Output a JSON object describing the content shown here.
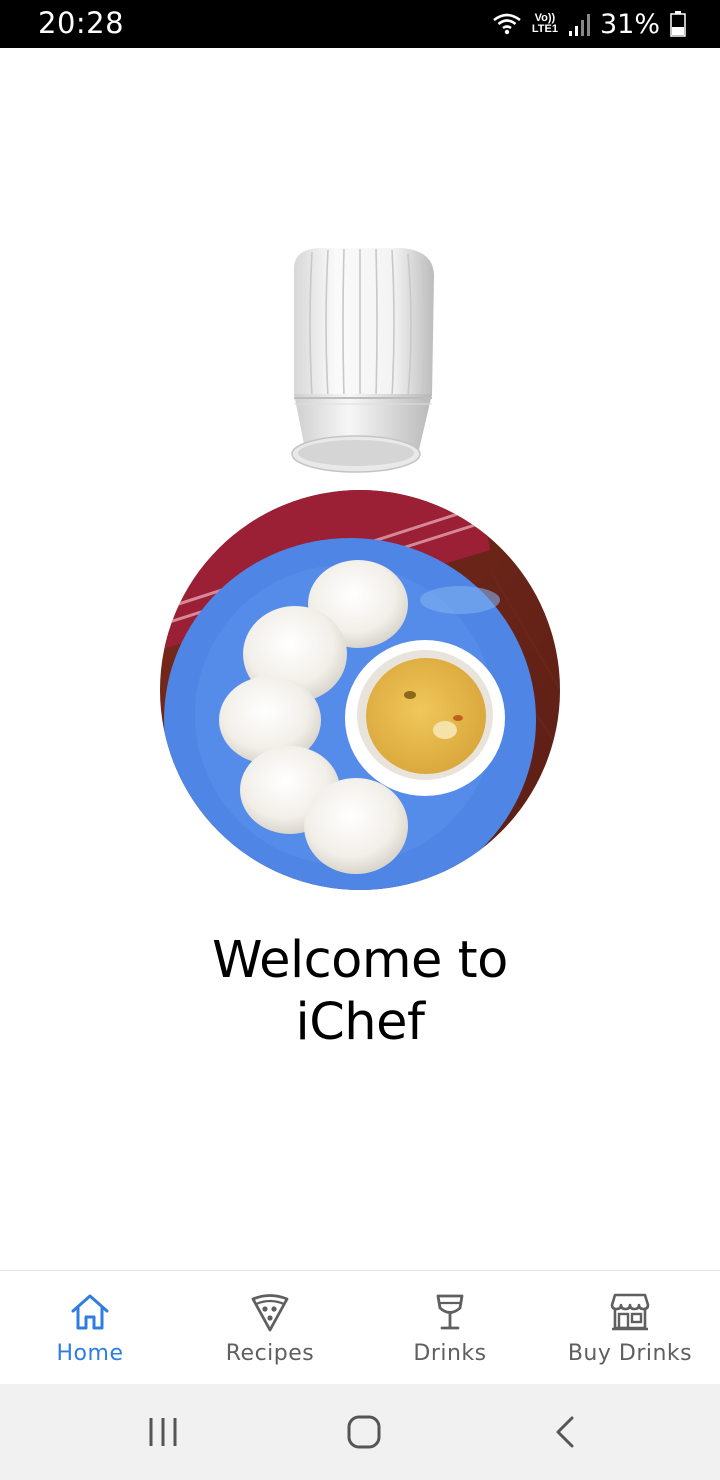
{
  "status_bar": {
    "time": "20:28",
    "volte_label": "Vo))",
    "lte_label": "LTE1",
    "battery_percent": "31%",
    "icons": [
      "wifi-icon",
      "volte-icon",
      "signal-icon",
      "battery-icon"
    ]
  },
  "main": {
    "welcome_line1": "Welcome to",
    "welcome_line2": "iChef",
    "images": [
      "chef-hat-image",
      "idli-sambar-photo"
    ]
  },
  "bottom_nav": {
    "items": [
      {
        "label": "Home",
        "icon": "home-icon",
        "active": true
      },
      {
        "label": "Recipes",
        "icon": "pizza-icon",
        "active": false
      },
      {
        "label": "Drinks",
        "icon": "wine-glass-icon",
        "active": false
      },
      {
        "label": "Buy Drinks",
        "icon": "store-icon",
        "active": false
      }
    ]
  },
  "system_nav": {
    "buttons": [
      "recent-apps-icon",
      "home-circle-icon",
      "back-icon"
    ]
  },
  "colors": {
    "accent": "#2f7de1",
    "inactive": "#5f5f5f",
    "status_bar": "#000000",
    "system_nav": "#f1f1f1",
    "plate": "#4f86e6"
  }
}
